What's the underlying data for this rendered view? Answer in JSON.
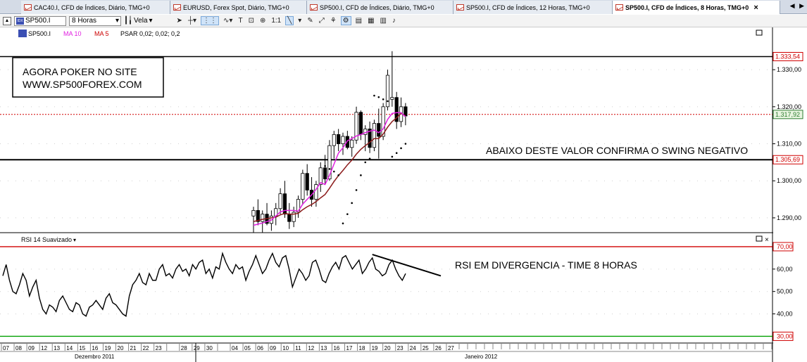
{
  "tabs": [
    {
      "label": "CAC40.I, CFD de Índices, Diário, TMG+0",
      "active": false
    },
    {
      "label": "EURUSD, Forex Spot, Diário, TMG+0",
      "active": false
    },
    {
      "label": "SP500.I, CFD de Índices, Diário, TMG+0",
      "active": false
    },
    {
      "label": "SP500.I, CFD de Índices, 12 Horas, TMG+0",
      "active": false
    },
    {
      "label": "SP500.I, CFD de Índices, 8 Horas, TMG+0",
      "active": true
    }
  ],
  "toolbar": {
    "symbol": "SP500.I",
    "symbol_icon": "index-icon",
    "timeframe": "8 Horas",
    "chart_type": "Vela"
  },
  "indicators_bar": {
    "symbol": "SP500.I",
    "ma10": "MA 10",
    "ma5": "MA 5",
    "psar": "PSAR 0,02; 0,02; 0,2"
  },
  "rsi_label": "RSI 14 Suavizado",
  "annotations": {
    "promo_line1": "AGORA POKER NO SITE",
    "promo_line2": "WWW.SP500FOREX.COM",
    "swing_note": "ABAIXO DESTE VALOR CONFIRMA O SWING NEGATIVO",
    "rsi_note": "RSI EM DIVERGENCIA - TIME 8 HORAS"
  },
  "colors": {
    "price_candle": "#000000",
    "ma10": "#8b1a1a",
    "ma5": "#e020e0",
    "psar": "#000000",
    "current_price_line": "#d00000",
    "rsi_upper": "#d00000",
    "rsi_lower": "#00a000",
    "axis_label_green_bg": "#e8f5e0"
  },
  "chart_data": {
    "type": "candlestick",
    "title": "",
    "price_axis": {
      "ticks": [
        1290.0,
        1300.0,
        1310.0,
        1320.0,
        1330.0
      ],
      "tick_labels": [
        "1.290,00",
        "1.300,00",
        "1.310,00",
        "1.320,00",
        "1.330,00"
      ],
      "ylim": [
        1286.0,
        1338.0
      ],
      "level_high": {
        "value": 1333.54,
        "label": "1.333,54"
      },
      "level_current": {
        "value": 1317.92,
        "label": "1.317,92"
      },
      "level_swing": {
        "value": 1305.69,
        "label": "1.305,69"
      }
    },
    "candles": [
      {
        "i": 0,
        "o": 1290.5,
        "h": 1293.0,
        "l": 1286.0,
        "c": 1292.0
      },
      {
        "i": 1,
        "o": 1292.0,
        "h": 1295.0,
        "l": 1288.0,
        "c": 1289.0
      },
      {
        "i": 2,
        "o": 1289.0,
        "h": 1292.0,
        "l": 1286.0,
        "c": 1291.0
      },
      {
        "i": 3,
        "o": 1291.0,
        "h": 1294.0,
        "l": 1288.0,
        "c": 1288.5
      },
      {
        "i": 4,
        "o": 1288.5,
        "h": 1292.0,
        "l": 1286.5,
        "c": 1290.5
      },
      {
        "i": 5,
        "o": 1290.5,
        "h": 1294.0,
        "l": 1288.0,
        "c": 1292.5
      },
      {
        "i": 6,
        "o": 1292.5,
        "h": 1298.0,
        "l": 1291.0,
        "c": 1296.5
      },
      {
        "i": 7,
        "o": 1296.5,
        "h": 1300.0,
        "l": 1290.0,
        "c": 1291.0
      },
      {
        "i": 8,
        "o": 1291.0,
        "h": 1294.0,
        "l": 1287.0,
        "c": 1289.0
      },
      {
        "i": 9,
        "o": 1289.0,
        "h": 1293.0,
        "l": 1287.5,
        "c": 1291.5
      },
      {
        "i": 10,
        "o": 1291.5,
        "h": 1296.0,
        "l": 1290.0,
        "c": 1295.0
      },
      {
        "i": 11,
        "o": 1295.0,
        "h": 1303.0,
        "l": 1293.5,
        "c": 1302.0
      },
      {
        "i": 12,
        "o": 1302.0,
        "h": 1304.5,
        "l": 1296.0,
        "c": 1297.5
      },
      {
        "i": 13,
        "o": 1297.5,
        "h": 1301.0,
        "l": 1293.0,
        "c": 1295.0
      },
      {
        "i": 14,
        "o": 1295.0,
        "h": 1300.0,
        "l": 1293.0,
        "c": 1299.0
      },
      {
        "i": 15,
        "o": 1299.0,
        "h": 1305.0,
        "l": 1297.0,
        "c": 1303.5
      },
      {
        "i": 16,
        "o": 1303.5,
        "h": 1307.0,
        "l": 1299.0,
        "c": 1300.5
      },
      {
        "i": 17,
        "o": 1300.5,
        "h": 1311.0,
        "l": 1300.0,
        "c": 1309.5
      },
      {
        "i": 18,
        "o": 1309.5,
        "h": 1313.5,
        "l": 1306.0,
        "c": 1312.5
      },
      {
        "i": 19,
        "o": 1312.5,
        "h": 1314.0,
        "l": 1308.0,
        "c": 1310.0
      },
      {
        "i": 20,
        "o": 1310.0,
        "h": 1313.0,
        "l": 1307.0,
        "c": 1312.0
      },
      {
        "i": 21,
        "o": 1312.0,
        "h": 1313.5,
        "l": 1308.5,
        "c": 1309.0
      },
      {
        "i": 22,
        "o": 1309.0,
        "h": 1312.0,
        "l": 1306.5,
        "c": 1311.0
      },
      {
        "i": 23,
        "o": 1311.0,
        "h": 1320.0,
        "l": 1310.0,
        "c": 1318.5
      },
      {
        "i": 24,
        "o": 1318.5,
        "h": 1319.0,
        "l": 1311.0,
        "c": 1312.5
      },
      {
        "i": 25,
        "o": 1312.5,
        "h": 1315.0,
        "l": 1308.0,
        "c": 1314.0
      },
      {
        "i": 26,
        "o": 1314.0,
        "h": 1316.0,
        "l": 1307.5,
        "c": 1309.0
      },
      {
        "i": 27,
        "o": 1309.0,
        "h": 1316.5,
        "l": 1308.0,
        "c": 1315.5
      },
      {
        "i": 28,
        "o": 1315.5,
        "h": 1319.5,
        "l": 1306.0,
        "c": 1312.0
      },
      {
        "i": 29,
        "o": 1312.0,
        "h": 1321.0,
        "l": 1311.0,
        "c": 1320.0
      },
      {
        "i": 30,
        "o": 1320.0,
        "h": 1330.0,
        "l": 1319.0,
        "c": 1328.5
      },
      {
        "i": 31,
        "o": 1322.0,
        "h": 1335.0,
        "l": 1320.0,
        "c": 1322.5
      },
      {
        "i": 32,
        "o": 1322.5,
        "h": 1324.0,
        "l": 1314.0,
        "c": 1316.0
      },
      {
        "i": 33,
        "o": 1316.0,
        "h": 1322.5,
        "l": 1314.5,
        "c": 1320.0
      },
      {
        "i": 34,
        "o": 1320.0,
        "h": 1321.0,
        "l": 1315.0,
        "c": 1317.5
      }
    ],
    "ma10": [
      1289.0,
      1289.3,
      1289.6,
      1289.8,
      1290.0,
      1290.2,
      1290.8,
      1291.2,
      1291.0,
      1291.0,
      1291.2,
      1292.2,
      1293.0,
      1293.6,
      1294.4,
      1295.4,
      1296.3,
      1298.0,
      1299.8,
      1301.4,
      1302.8,
      1304.3,
      1305.6,
      1307.2,
      1308.5,
      1309.5,
      1310.4,
      1311.4,
      1311.4,
      1312.6,
      1314.5,
      1316.0,
      1317.0,
      1318.2,
      1317.5
    ],
    "ma5": [
      1288.0,
      1288.3,
      1288.6,
      1289.0,
      1289.4,
      1290.5,
      1291.6,
      1292.0,
      1292.0,
      1292.0,
      1291.8,
      1293.7,
      1295.0,
      1296.2,
      1297.7,
      1299.5,
      1299.0,
      1301.5,
      1304.5,
      1307.5,
      1308.9,
      1310.8,
      1311.4,
      1312.1,
      1312.5,
      1313.0,
      1313.4,
      1313.7,
      1313.0,
      1314.0,
      1316.6,
      1318.2,
      1318.4,
      1318.4,
      1317.3
    ],
    "psar_points": [
      {
        "i": 16,
        "v": 1304.0
      },
      {
        "i": 17,
        "v": 1303.2
      },
      {
        "i": 18,
        "v": 1302.5
      },
      {
        "i": 19,
        "v": 1301.5
      },
      {
        "i": 20,
        "v": 1288.5
      },
      {
        "i": 21,
        "v": 1291.0
      },
      {
        "i": 22,
        "v": 1294.0
      },
      {
        "i": 23,
        "v": 1297.5
      },
      {
        "i": 24,
        "v": 1301.5
      },
      {
        "i": 25,
        "v": 1305.0
      },
      {
        "i": 26,
        "v": 1306.0
      },
      {
        "i": 27,
        "v": 1323.0
      },
      {
        "i": 28,
        "v": 1322.6
      },
      {
        "i": 29,
        "v": 1322.0
      },
      {
        "i": 30,
        "v": 1321.5
      },
      {
        "i": 31,
        "v": 1306.5
      },
      {
        "i": 32,
        "v": 1307.5
      },
      {
        "i": 33,
        "v": 1308.8
      },
      {
        "i": 34,
        "v": 1310.0
      }
    ],
    "rsi": {
      "ticks": [
        40.0,
        50.0,
        60.0,
        70.0,
        30.0
      ],
      "tick_labels": [
        "40,00",
        "50,00",
        "60,00",
        "70,00",
        "30,00"
      ],
      "ylim": [
        27.0,
        75.0
      ],
      "upper": 70.0,
      "lower": 30.0,
      "values": [
        57,
        62,
        55,
        50,
        49,
        53,
        58,
        55,
        48,
        52,
        55,
        47,
        42,
        40,
        44,
        43,
        41,
        46,
        48,
        45,
        42,
        41,
        45,
        44,
        40,
        39,
        43,
        44,
        46,
        44,
        42,
        47,
        49,
        45,
        44,
        42,
        40,
        39,
        48,
        53,
        55,
        58,
        54,
        53,
        58,
        55,
        55,
        60,
        62,
        57,
        58,
        56,
        60,
        62,
        59,
        60,
        57,
        62,
        60,
        63,
        64,
        58,
        60,
        56,
        61,
        60,
        67,
        63,
        60,
        58,
        62,
        60,
        61,
        55,
        59,
        62,
        66,
        62,
        58,
        60,
        64,
        67,
        63,
        61,
        65,
        66,
        60,
        52,
        56,
        60,
        58,
        55,
        57,
        63,
        64,
        60,
        55,
        54,
        58,
        61,
        63,
        60,
        65,
        66,
        63,
        60,
        62,
        64,
        58,
        60,
        63,
        65,
        60,
        59,
        57,
        58,
        62,
        64,
        60,
        57,
        55,
        58
      ],
      "divergence_line": {
        "from": [
          111,
          66.5
        ],
        "to": [
          145,
          59.5
        ]
      }
    },
    "x_axis": {
      "labels": [
        "07",
        "08",
        "09",
        "12",
        "13",
        "14",
        "15",
        "16",
        "19",
        "20",
        "21",
        "22",
        "23",
        "",
        "28",
        "29",
        "30",
        "",
        "04",
        "05",
        "06",
        "09",
        "10",
        "11",
        "12",
        "13",
        "16",
        "17",
        "18",
        "19",
        "20",
        "23",
        "24",
        "25",
        "26",
        "27"
      ],
      "months": [
        "Dezembro 2011",
        "Janeiro 2012"
      ]
    }
  }
}
